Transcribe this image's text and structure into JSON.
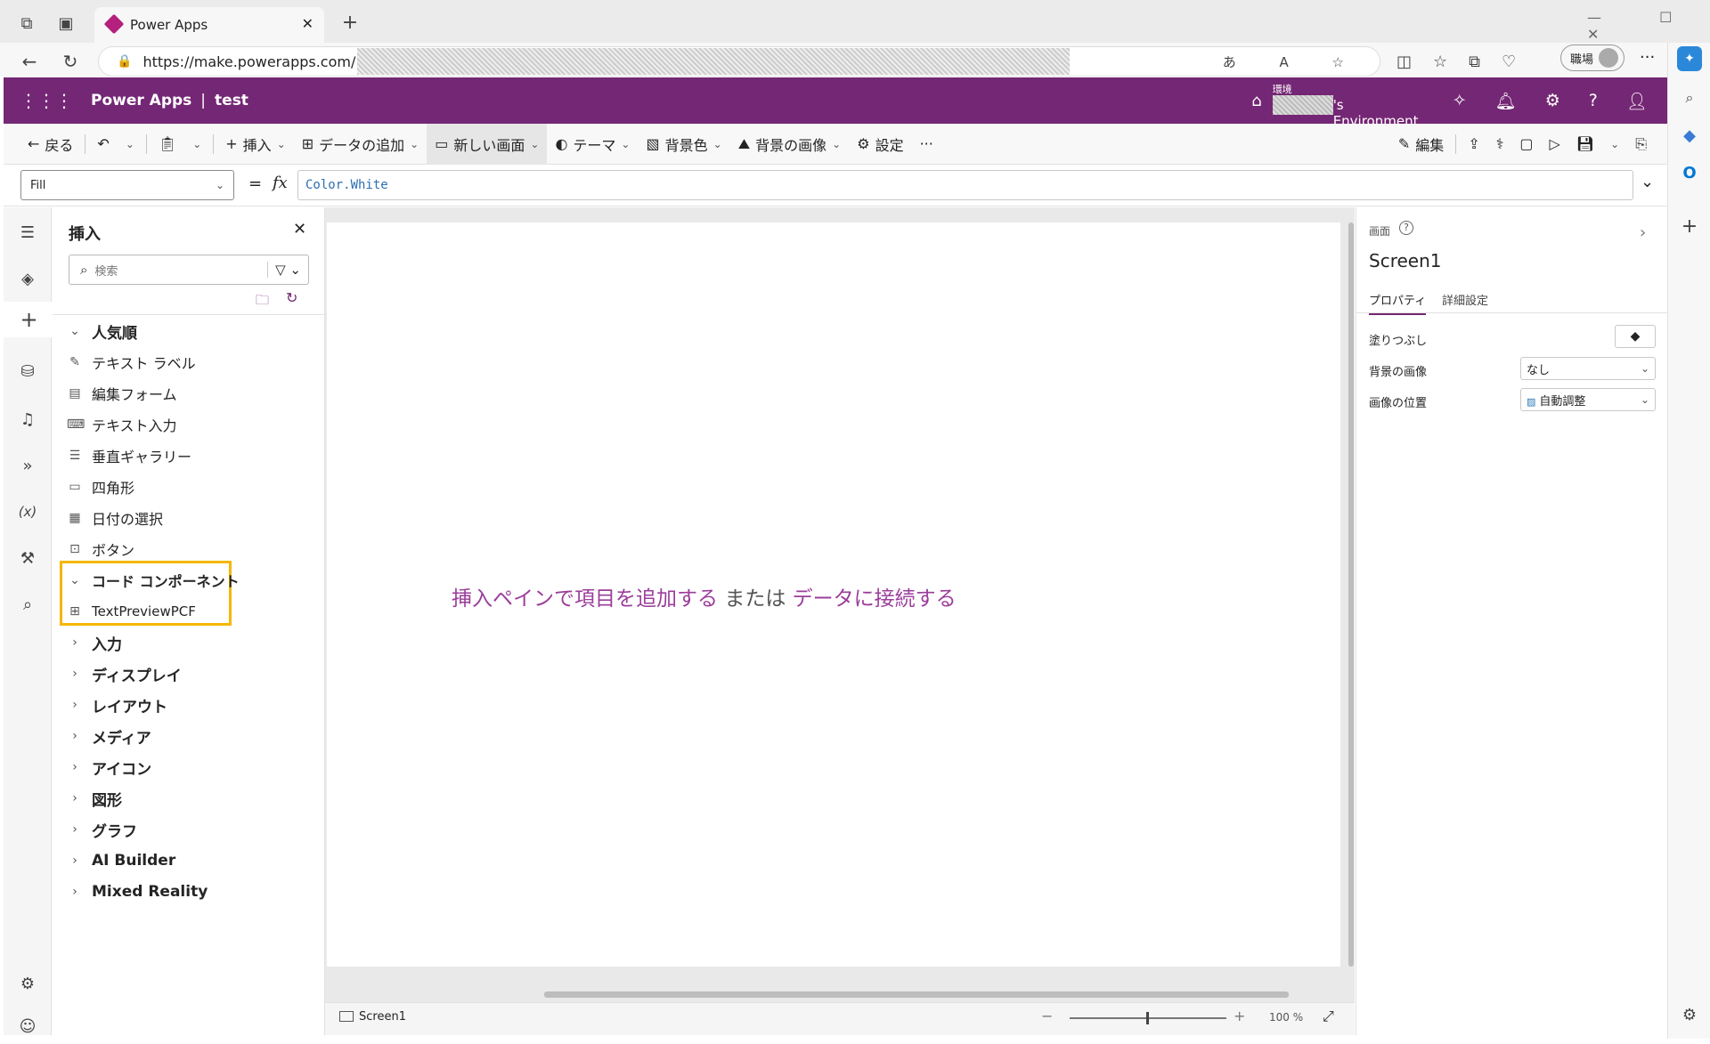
{
  "browser": {
    "tab_title": "Power Apps",
    "url": "https://make.powerapps.com/",
    "profile_label": "職場"
  },
  "header": {
    "app_name": "Power Apps",
    "separator": "|",
    "app_title": "test",
    "env_label": "環境",
    "env_name": "'s Environment"
  },
  "cmdbar": {
    "back": "戻る",
    "insert": "挿入",
    "add_data": "データの追加",
    "new_screen": "新しい画面",
    "theme": "テーマ",
    "bg_color": "背景色",
    "bg_image": "背景の画像",
    "settings": "設定",
    "more": "···",
    "edit": "編集"
  },
  "formula": {
    "property": "Fill",
    "eq": "=",
    "fx": "fx",
    "value": "Color.White"
  },
  "insert_pane": {
    "title": "挿入",
    "search_placeholder": "検索",
    "popular_group": "人気順",
    "popular_items": [
      {
        "label": "テキスト ラベル",
        "icon": "label-icon"
      },
      {
        "label": "編集フォーム",
        "icon": "form-icon"
      },
      {
        "label": "テキスト入力",
        "icon": "text-input-icon"
      },
      {
        "label": "垂直ギャラリー",
        "icon": "gallery-icon"
      },
      {
        "label": "四角形",
        "icon": "rectangle-icon"
      },
      {
        "label": "日付の選択",
        "icon": "calendar-icon"
      },
      {
        "label": "ボタン",
        "icon": "button-icon"
      }
    ],
    "code_group": "コード コンポーネント",
    "code_item": "TextPreviewPCF",
    "groups": [
      "入力",
      "ディスプレイ",
      "レイアウト",
      "メディア",
      "アイコン",
      "図形",
      "グラフ",
      "AI Builder",
      "Mixed Reality"
    ]
  },
  "canvas": {
    "hint_link1": "挿入ペインで項目を追加する",
    "hint_mid": "または",
    "hint_link2": "データに接続する"
  },
  "statusbar": {
    "screen_name": "Screen1",
    "zoom": "100 %",
    "minus": "−",
    "plus": "+"
  },
  "right_pane": {
    "section": "画面",
    "screen_name": "Screen1",
    "tab_properties": "プロパティ",
    "tab_advanced": "詳細設定",
    "fill_label": "塗りつぶし",
    "bg_image_label": "背景の画像",
    "bg_image_value": "なし",
    "image_pos_label": "画像の位置",
    "image_pos_value": "自動調整"
  },
  "colors": {
    "brand": "#742774",
    "highlight_box": "#f5b700",
    "link": "#9b3d9b"
  }
}
